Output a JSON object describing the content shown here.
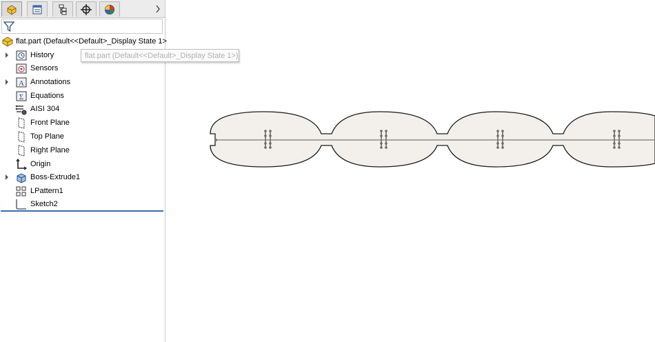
{
  "feature_manager": {
    "tabs": [
      {
        "name": "FeatureManager design tree",
        "icon": "featuremanager-icon",
        "active": true
      },
      {
        "name": "PropertyManager",
        "icon": "propertymanager-icon",
        "active": false
      },
      {
        "name": "ConfigurationManager",
        "icon": "configurationmanager-icon",
        "active": false
      },
      {
        "name": "DimXpertManager",
        "icon": "dimxpert-icon",
        "active": false
      },
      {
        "name": "DisplayManager",
        "icon": "displaymanager-icon",
        "active": false
      }
    ],
    "root_label": "flat.part  (Default<<Default>_Display State 1>",
    "tooltip": "flat.part  (Default<<Default>_Display State 1>)",
    "items": [
      {
        "label": "History",
        "icon": "history-icon",
        "expandable": true
      },
      {
        "label": "Sensors",
        "icon": "sensors-icon",
        "expandable": false
      },
      {
        "label": "Annotations",
        "icon": "annotations-icon",
        "expandable": true
      },
      {
        "label": "Equations",
        "icon": "equations-icon",
        "expandable": false
      },
      {
        "label": "AISI 304",
        "icon": "material-icon",
        "expandable": false
      },
      {
        "label": "Front Plane",
        "icon": "plane-icon",
        "expandable": false
      },
      {
        "label": "Top Plane",
        "icon": "plane-icon",
        "expandable": false
      },
      {
        "label": "Right Plane",
        "icon": "plane-icon",
        "expandable": false
      },
      {
        "label": "Origin",
        "icon": "origin-icon",
        "expandable": false
      },
      {
        "label": "Boss-Extrude1",
        "icon": "extrude-icon",
        "expandable": true
      },
      {
        "label": "LPattern1",
        "icon": "linear-pattern-icon",
        "expandable": false
      },
      {
        "label": "Sketch2",
        "icon": "sketch-icon",
        "expandable": false
      }
    ]
  },
  "colors": {
    "part_fill": "#f3f0eb",
    "part_edge": "#1a1a1a",
    "centerline": "#8a8a8a",
    "selection_bar": "#3a6ea8"
  }
}
